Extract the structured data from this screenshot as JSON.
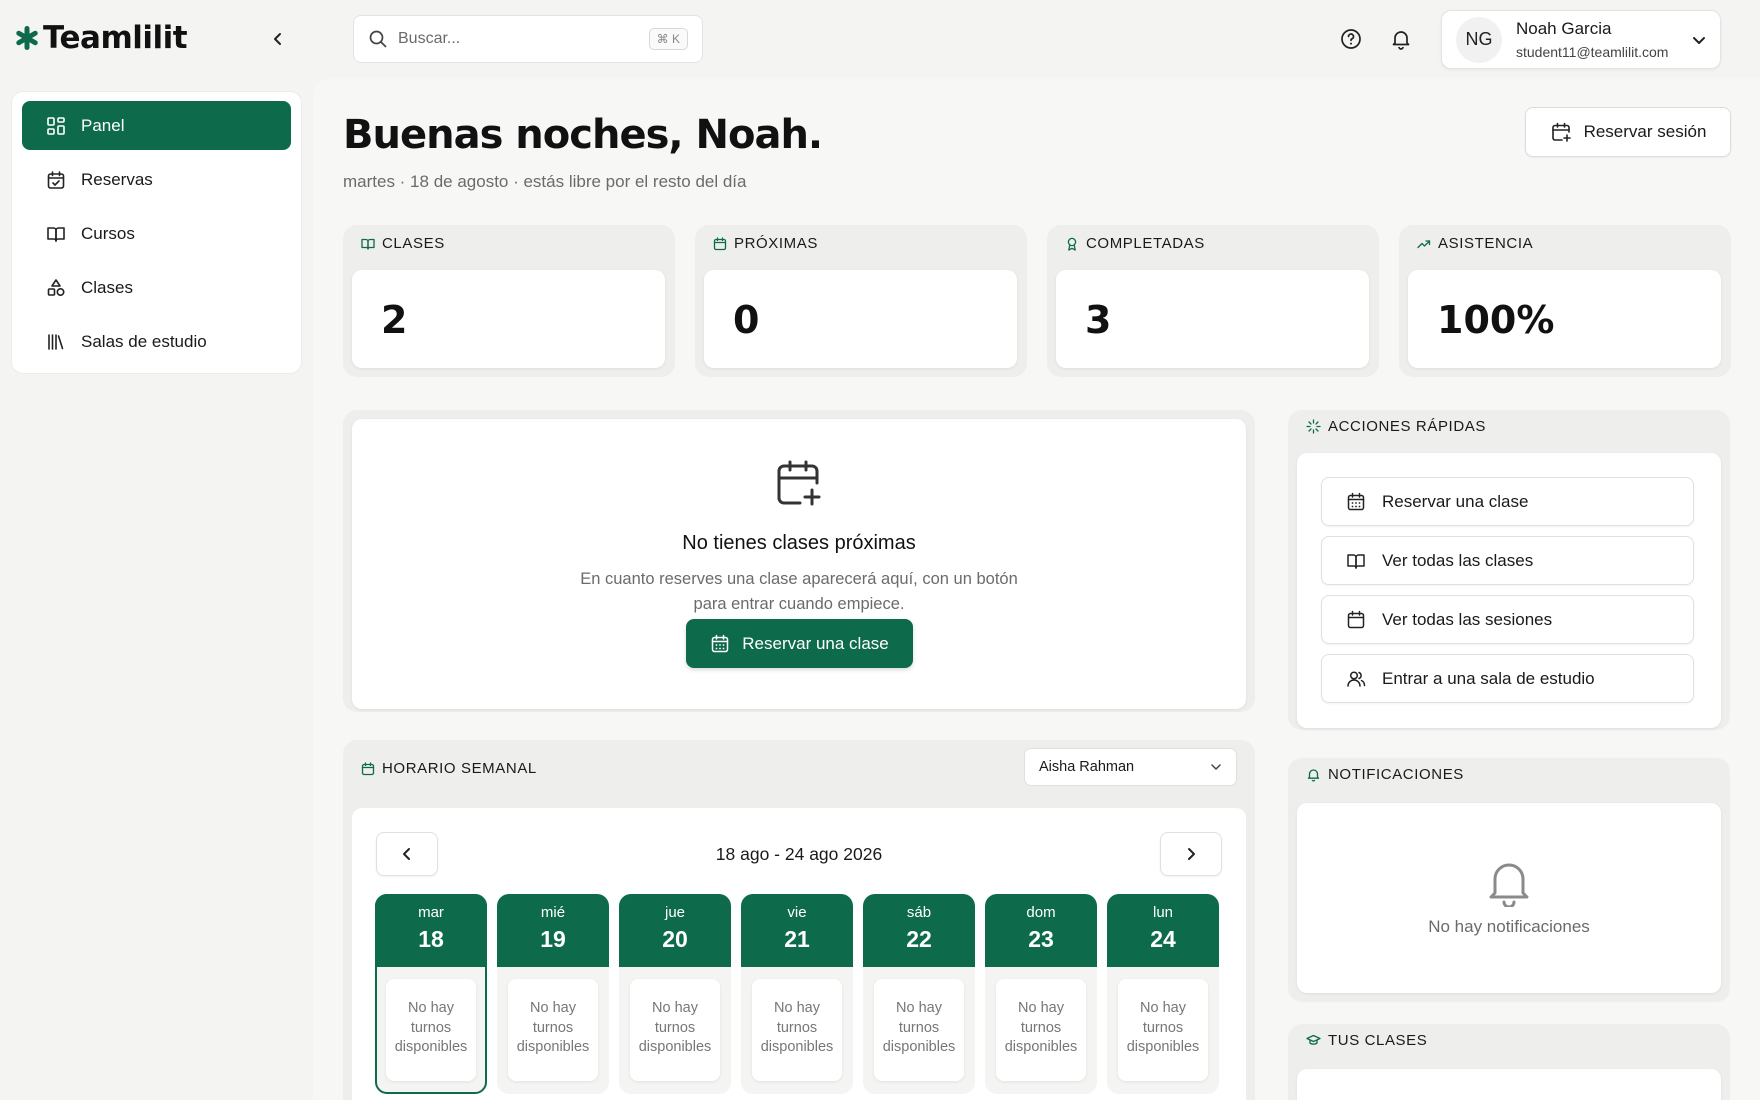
{
  "app": {
    "name": "Teamlilit"
  },
  "search": {
    "placeholder": "Buscar...",
    "shortcut": "⌘ K"
  },
  "user": {
    "initials": "NG",
    "name": "Noah Garcia",
    "email": "student11@teamlilit.com"
  },
  "sidebar": {
    "items": [
      {
        "label": "Panel",
        "icon": "dashboard-icon",
        "active": true
      },
      {
        "label": "Reservas",
        "icon": "calendar-check-icon"
      },
      {
        "label": "Cursos",
        "icon": "book-open-icon"
      },
      {
        "label": "Clases",
        "icon": "shapes-icon"
      },
      {
        "label": "Salas de estudio",
        "icon": "library-icon"
      }
    ]
  },
  "header": {
    "greeting": "Buenas noches, Noah.",
    "subtitle": "martes · 18 de agosto · estás libre por el resto del día",
    "book_session_label": "Reservar sesión"
  },
  "stats": [
    {
      "label": "CLASES",
      "value": "2",
      "icon": "book-open-icon"
    },
    {
      "label": "PRÓXIMAS",
      "value": "0",
      "icon": "calendar-icon"
    },
    {
      "label": "COMPLETADAS",
      "value": "3",
      "icon": "award-icon"
    },
    {
      "label": "ASISTENCIA",
      "value": "100%",
      "icon": "trending-up-icon"
    }
  ],
  "upcoming": {
    "title": "No tienes clases próximas",
    "desc_line1": "En cuanto reserves una clase aparecerá aquí, con un botón",
    "desc_line2": "para entrar cuando empiece.",
    "button_label": "Reservar una clase"
  },
  "weekly": {
    "label": "HORARIO SEMANAL",
    "tutor": "Aisha Rahman",
    "range": "18 ago - 24 ago 2026",
    "days": [
      {
        "name": "mar",
        "num": "18",
        "slot": [
          "No hay",
          "turnos",
          "disponibles"
        ],
        "today": true
      },
      {
        "name": "mié",
        "num": "19",
        "slot": [
          "No hay",
          "turnos",
          "disponibles"
        ]
      },
      {
        "name": "jue",
        "num": "20",
        "slot": [
          "No hay",
          "turnos",
          "disponibles"
        ]
      },
      {
        "name": "vie",
        "num": "21",
        "slot": [
          "No hay",
          "turnos",
          "disponibles"
        ]
      },
      {
        "name": "sáb",
        "num": "22",
        "slot": [
          "No hay",
          "turnos",
          "disponibles"
        ]
      },
      {
        "name": "dom",
        "num": "23",
        "slot": [
          "No hay",
          "turnos",
          "disponibles"
        ]
      },
      {
        "name": "lun",
        "num": "24",
        "slot": [
          "No hay",
          "turnos",
          "disponibles"
        ]
      }
    ]
  },
  "quick_actions": {
    "label": "ACCIONES RÁPIDAS",
    "items": [
      {
        "label": "Reservar una clase",
        "icon": "calendar-grid-icon"
      },
      {
        "label": "Ver todas las clases",
        "icon": "book-open-icon"
      },
      {
        "label": "Ver todas las sesiones",
        "icon": "calendar-icon"
      },
      {
        "label": "Entrar a una sala de estudio",
        "icon": "users-icon"
      }
    ]
  },
  "notifications": {
    "label": "NOTIFICACIONES",
    "empty": "No hay notificaciones"
  },
  "your_classes": {
    "label": "TUS CLASES"
  },
  "colors": {
    "brand": "#0d6b4c",
    "background": "#f4f4f3"
  }
}
